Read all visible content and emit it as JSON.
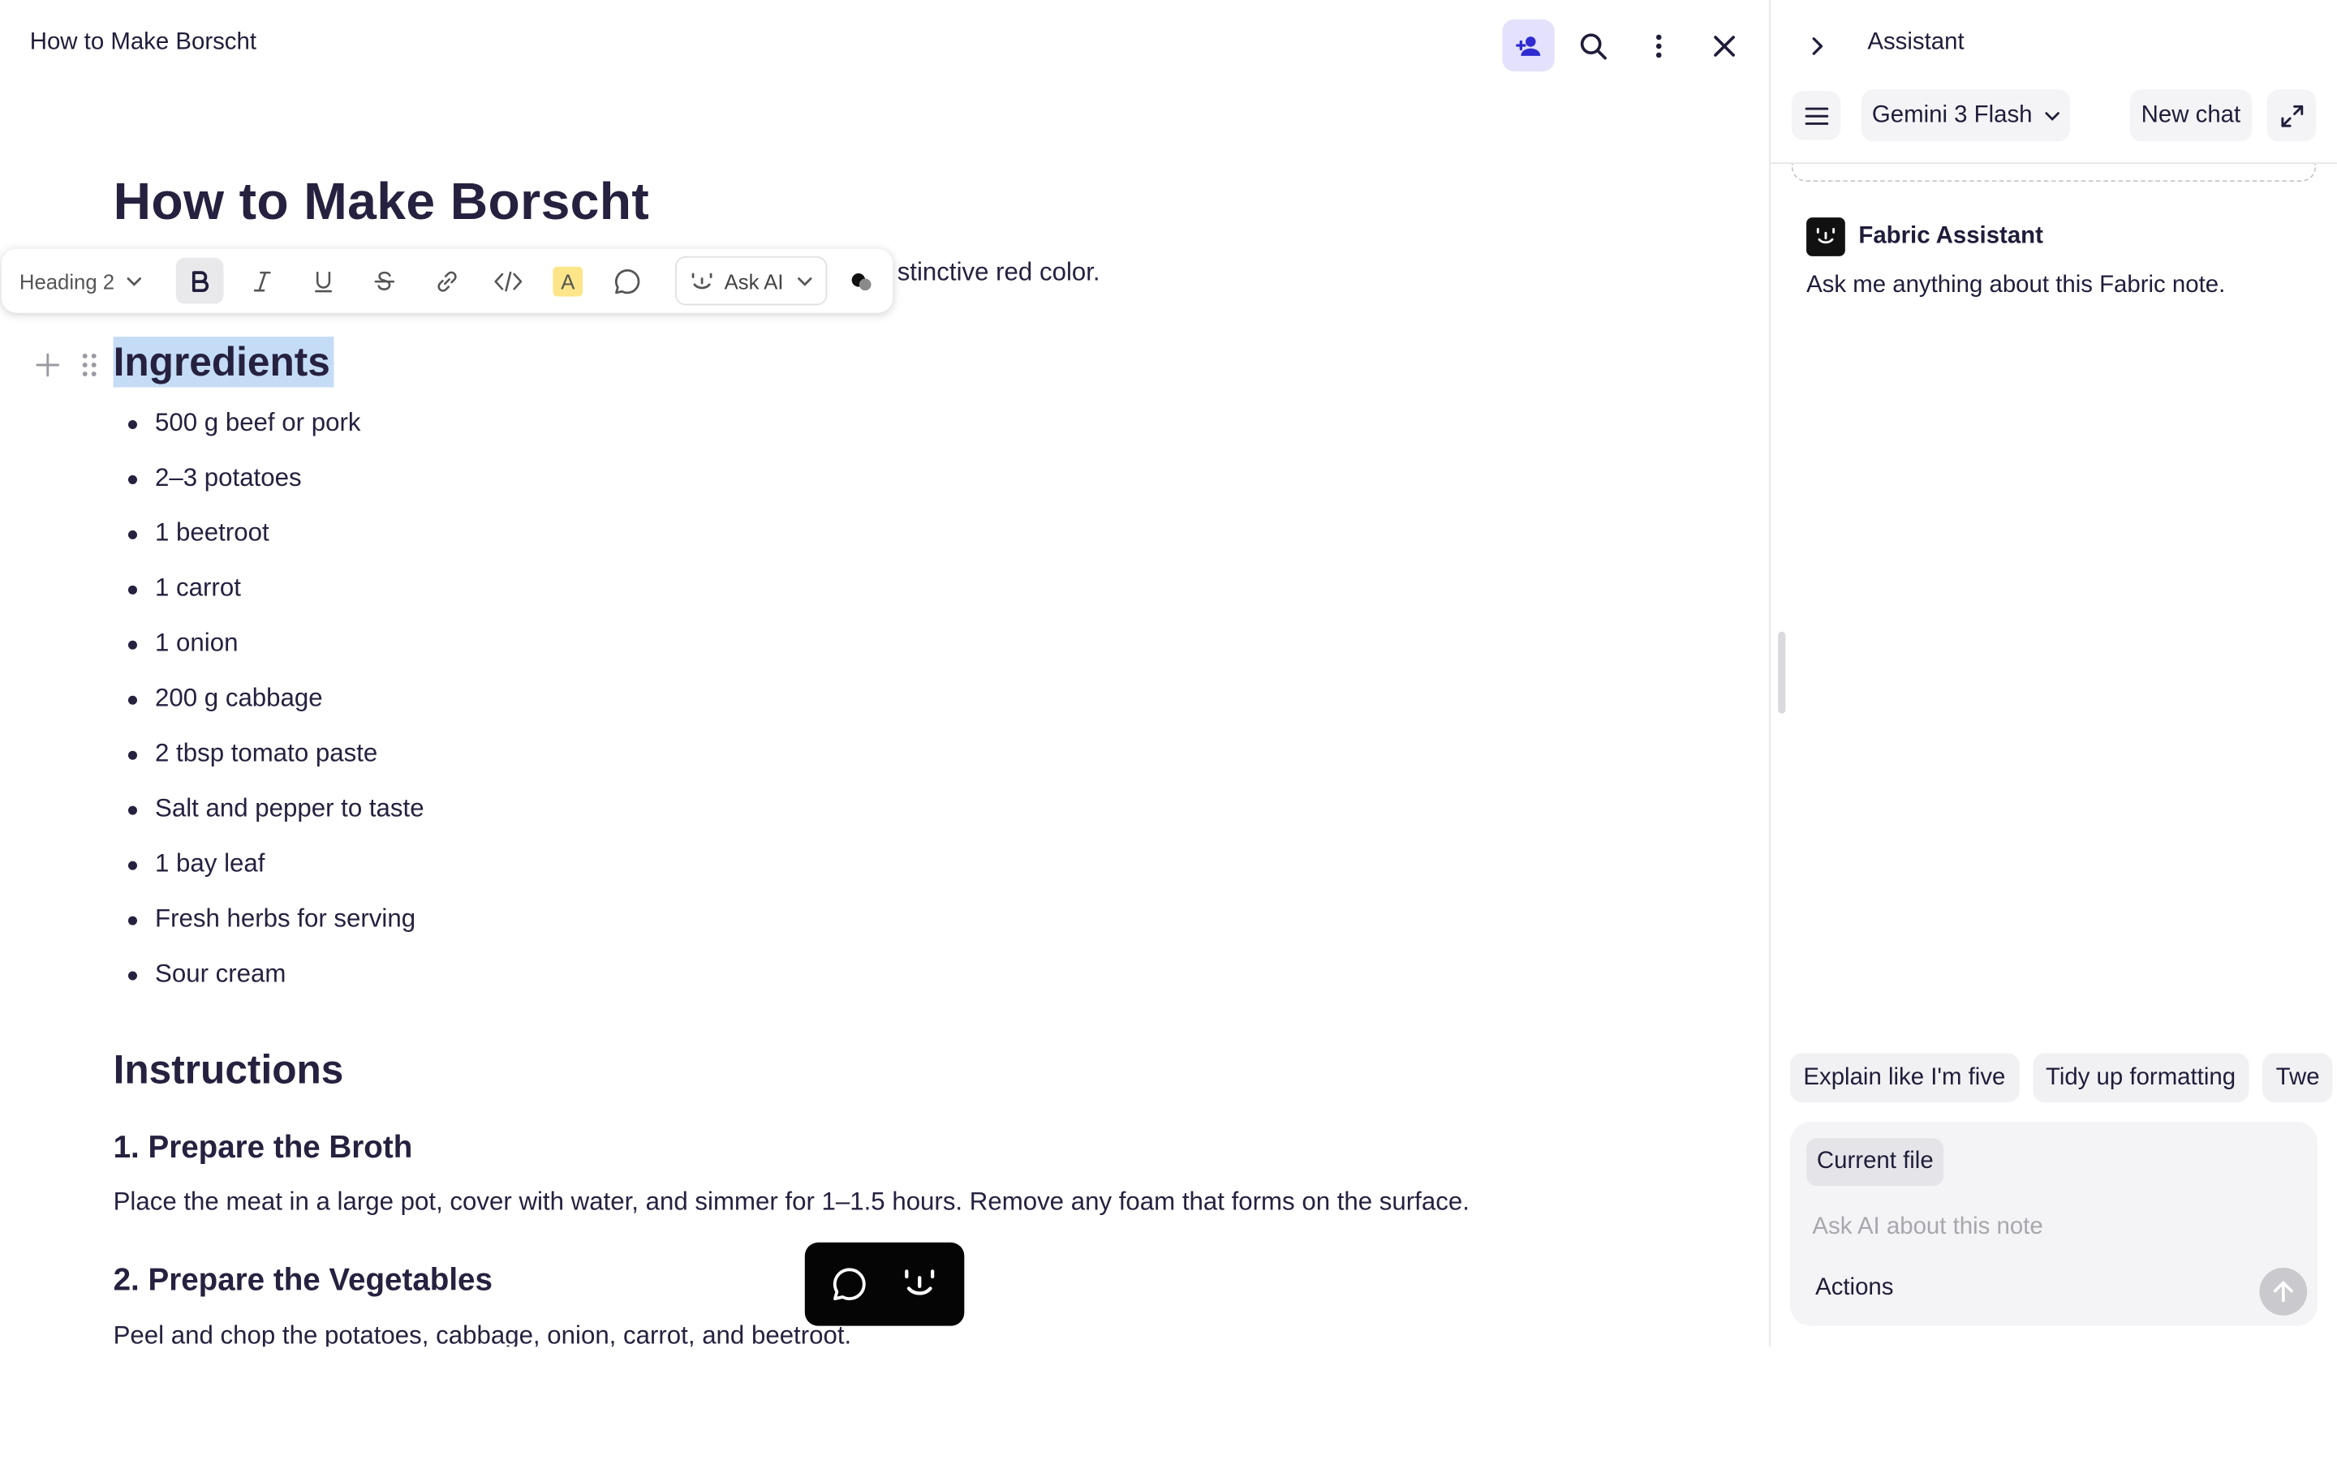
{
  "document": {
    "tab_title": "How to Make Borscht",
    "title": "How to Make Borscht",
    "intro_visible_tail": "stinctive red color.",
    "ingredients_heading": "Ingredients",
    "ingredients": [
      "500 g beef or pork",
      "2–3 potatoes",
      "1 beetroot",
      "1 carrot",
      "1 onion",
      "200 g cabbage",
      "2 tbsp tomato paste",
      "Salt and pepper to taste",
      "1 bay leaf",
      "Fresh herbs for serving",
      "Sour cream"
    ],
    "instructions_heading": "Instructions",
    "step1_heading": "1. Prepare the Broth",
    "step1_text": "Place the meat in a large pot, cover with water, and simmer for 1–1.5 hours. Remove any foam that forms on the surface.",
    "step2_heading": "2. Prepare the Vegetables",
    "step2_text": "Peel and chop the potatoes, cabbage, onion, carrot, and beetroot."
  },
  "top_actions": [
    "share-person-icon",
    "search-icon",
    "more-vertical-icon",
    "close-icon"
  ],
  "format_toolbar": {
    "block_type": "Heading 2",
    "bold_active": true,
    "ask_ai_label": "Ask AI",
    "highlight_letter": "A",
    "highlight_color": "#fde68a"
  },
  "assistant_panel": {
    "title": "Assistant",
    "model": "Gemini 3 Flash",
    "new_chat_label": "New chat",
    "assistant_name": "Fabric Assistant",
    "welcome_message": "Ask me anything about this Fabric note.",
    "suggestions": [
      "Explain like I'm five",
      "Tidy up formatting",
      "Twe"
    ],
    "context_chip": "Current file",
    "input_placeholder": "Ask AI about this note",
    "actions_label": "Actions"
  },
  "colors": {
    "accent_soft": "#e3e1fb",
    "accent_icon": "#2f2bd1",
    "selection": "#c5dcf6",
    "text": "#26213f"
  }
}
